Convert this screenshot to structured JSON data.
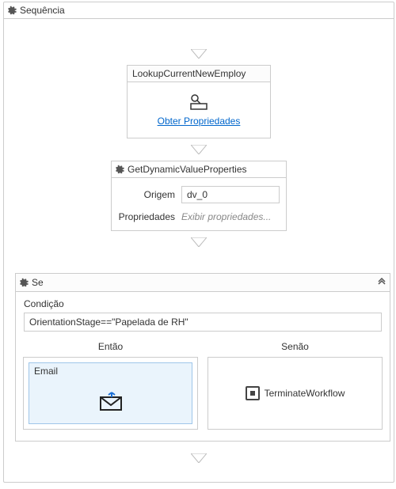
{
  "sequence": {
    "title": "Sequência"
  },
  "lookup": {
    "title": "LookupCurrentNewEmploy",
    "link_label": "Obter Propriedades"
  },
  "getdyn": {
    "title": "GetDynamicValueProperties",
    "origin_label": "Origem",
    "origin_value": "dv_0",
    "props_label": "Propriedades",
    "props_placeholder": "Exibir propriedades..."
  },
  "se": {
    "title": "Se",
    "condition_label": "Condição",
    "condition_value": "OrientationStage==\"Papelada de RH\"",
    "then_label": "Então",
    "else_label": "Senão",
    "email_title": "Email",
    "terminate_label": "TerminateWorkflow"
  }
}
